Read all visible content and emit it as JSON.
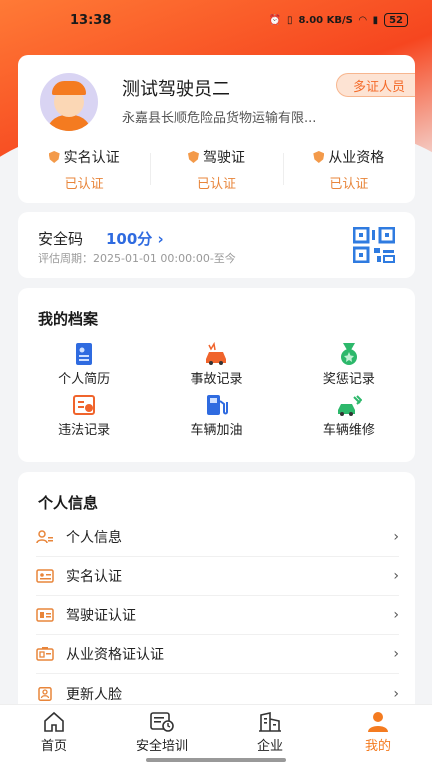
{
  "status_bar": {
    "time": "13:38",
    "speed": "8.00 KB/S",
    "battery": "52"
  },
  "profile": {
    "name": "测试驾驶员二",
    "company": "永嘉县长顺危险品货物运输有限...",
    "badge": "多证人员",
    "certs": [
      {
        "title": "实名认证",
        "status": "已认证"
      },
      {
        "title": "驾驶证",
        "status": "已认证"
      },
      {
        "title": "从业资格",
        "status": "已认证"
      }
    ]
  },
  "safety": {
    "label": "安全码",
    "score": "100分",
    "period": "评估周期：2025-01-01 00:00:00-至今"
  },
  "archive": {
    "title": "我的档案",
    "items": [
      {
        "label": "个人简历",
        "icon": "resume-icon"
      },
      {
        "label": "事故记录",
        "icon": "accident-icon"
      },
      {
        "label": "奖惩记录",
        "icon": "medal-icon"
      },
      {
        "label": "违法记录",
        "icon": "violation-icon"
      },
      {
        "label": "车辆加油",
        "icon": "fuel-icon"
      },
      {
        "label": "车辆维修",
        "icon": "repair-icon"
      }
    ]
  },
  "info": {
    "title": "个人信息",
    "rows": [
      {
        "label": "个人信息"
      },
      {
        "label": "实名认证"
      },
      {
        "label": "驾驶证认证"
      },
      {
        "label": "从业资格证认证"
      },
      {
        "label": "更新人脸"
      }
    ]
  },
  "tabs": [
    {
      "label": "首页"
    },
    {
      "label": "安全培训"
    },
    {
      "label": "企业"
    },
    {
      "label": "我的"
    }
  ],
  "colors": {
    "accent": "#f47b20",
    "link": "#2f6be0",
    "cert": "#e8853a"
  }
}
